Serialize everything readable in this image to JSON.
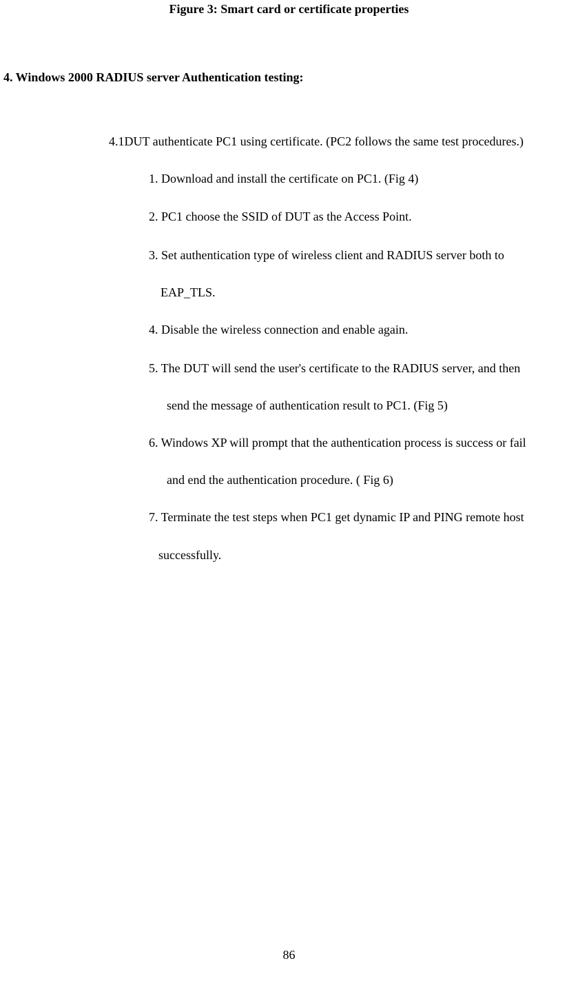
{
  "figure_caption": "Figure 3: Smart card or certificate properties",
  "section_heading": "4. Windows 2000 RADIUS server Authentication testing:",
  "intro": "4.1DUT authenticate PC1 using certificate. (PC2 follows the same test procedures.)",
  "steps": {
    "s1": "1.  Download and install the certificate on PC1. (Fig 4)",
    "s2": "2.  PC1 choose the SSID of DUT as the Access Point.",
    "s3": "3.  Set authentication type of wireless client and RADIUS server both to",
    "s3b": "EAP_TLS.",
    "s4": "4.  Disable the wireless connection and enable again.",
    "s5": "5.  The DUT will send the user's certificate to the RADIUS server, and then",
    "s5b": "send the message of authentication result to PC1. (Fig 5)",
    "s6": "6.  Windows XP will prompt that the authentication process is success or fail",
    "s6b": "and end the authentication procedure. ( Fig 6)",
    "s7": "7.  Terminate the test steps when PC1 get dynamic IP and PING remote host",
    "s7b": "successfully."
  },
  "page_number": "86"
}
